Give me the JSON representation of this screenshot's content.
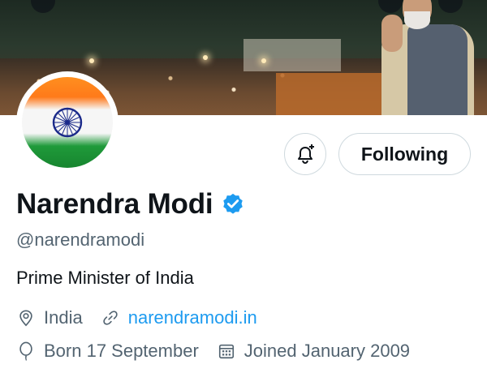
{
  "profile": {
    "name": "Narendra Modi",
    "handle": "@narendramodi",
    "bio": "Prime Minister of India",
    "location": "India",
    "website": "narendramodi.in",
    "birthday": "Born 17 September",
    "joined": "Joined January 2009",
    "verified": true
  },
  "actions": {
    "follow_label": "Following"
  },
  "icons": {
    "verified": "verified-badge-icon",
    "notifications": "bell-plus-icon",
    "location": "location-pin-icon",
    "website": "link-icon",
    "birthday": "balloon-icon",
    "joined": "calendar-icon"
  },
  "colors": {
    "accent": "#1d9bf0",
    "secondary_text": "#536471",
    "primary_text": "#0f1419",
    "border": "#cfd9de"
  }
}
